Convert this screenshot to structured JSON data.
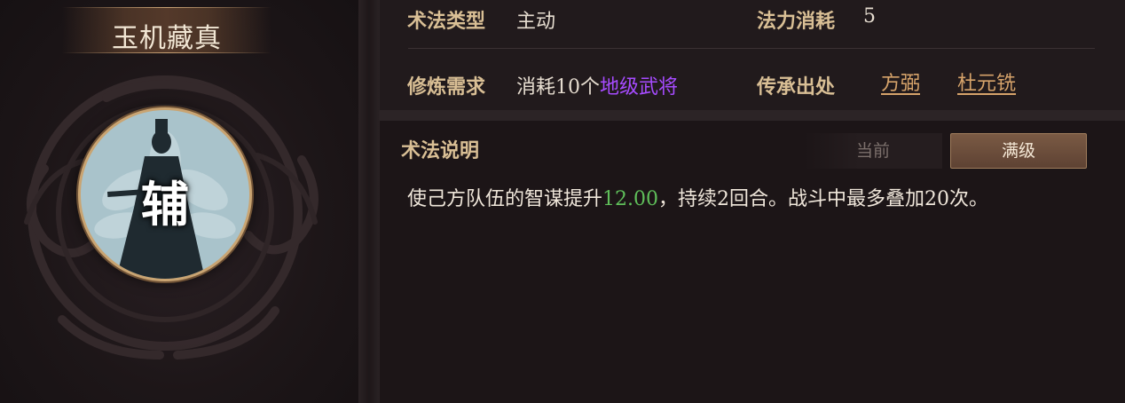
{
  "skill": {
    "name": "玉机藏真",
    "role_char": "辅"
  },
  "info": {
    "type_label": "术法类型",
    "type_value": "主动",
    "cost_label": "法力消耗",
    "cost_value": "5",
    "train_label": "修炼需求",
    "train_prefix": "消耗10个",
    "train_highlight": "地级武将",
    "source_label": "传承出处",
    "sources": [
      "方弼",
      "杜元铣"
    ]
  },
  "description": {
    "title": "术法说明",
    "tabs": {
      "current": "当前",
      "max": "满级"
    },
    "selected_tab": "满级",
    "text_before": "使己方队伍的智谋提升",
    "text_value": "12.00",
    "text_after": "，持续2回合。战斗中最多叠加20次。"
  },
  "colors": {
    "label_gold": "#d9bf95",
    "highlight_purple": "#a64bff",
    "value_green": "#5fbf5a",
    "link_orange": "#d6a36a"
  }
}
